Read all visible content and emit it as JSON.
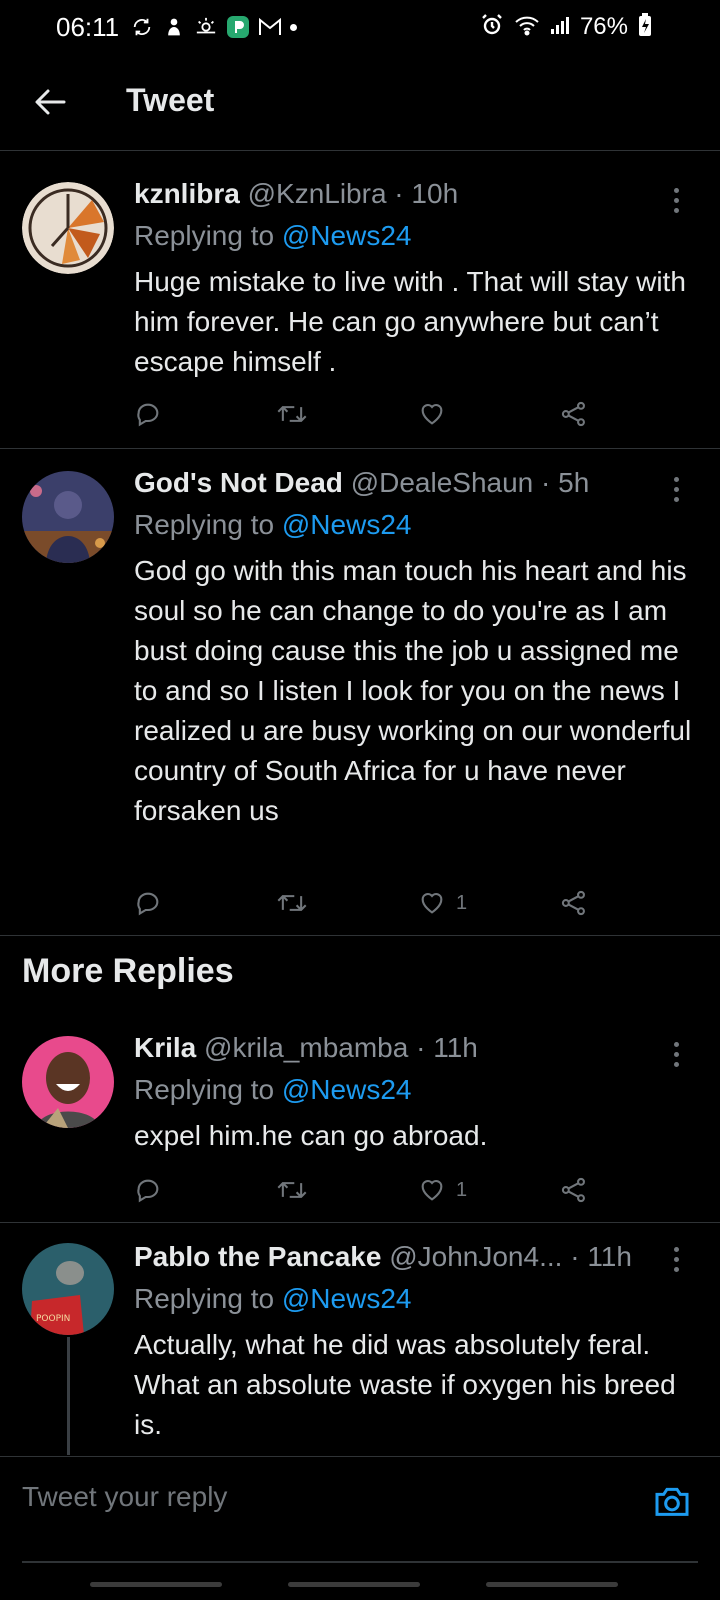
{
  "status_bar": {
    "time": "06:11",
    "battery": "76%",
    "left_icons": [
      "sync-icon",
      "person-icon",
      "weather-icon",
      "app-icon",
      "gmail-icon",
      "dot-icon"
    ],
    "right_icons": [
      "alarm-icon",
      "wifi-icon",
      "signal-icon",
      "battery-icon"
    ]
  },
  "header": {
    "title": "Tweet"
  },
  "tweets": [
    {
      "name": "kznlibra",
      "handle": "@KznLibra",
      "sep": " · ",
      "time": "10h",
      "replying_label": "Replying to ",
      "replying_to": "@News24",
      "body": "Huge mistake to live with . That will stay with him forever. He can go anywhere but can’t escape himself .",
      "likes": ""
    },
    {
      "name": "God's Not Dead",
      "handle": "@DealeShaun",
      "sep": " · ",
      "time": "5h",
      "replying_label": "Replying to ",
      "replying_to": "@News24",
      "body": "God go with this man touch his heart and his soul so he can change to do you're as I am bust doing cause this the job u assigned me to and so I listen I look for you on the news I realized u are busy working on our wonderful country of South Africa for u have never forsaken us",
      "likes": "1"
    }
  ],
  "more_replies": {
    "title": "More Replies",
    "tweets": [
      {
        "name": "Krila",
        "handle": "@krila_mbamba",
        "sep": " · ",
        "time": "11h",
        "replying_label": "Replying to ",
        "replying_to": "@News24",
        "body": "expel him.he can go abroad.",
        "likes": "1"
      },
      {
        "name": "Pablo the Pancake",
        "handle": "@JohnJon4...",
        "sep": "  · ",
        "time": "11h",
        "replying_label": "Replying to ",
        "replying_to": "@News24",
        "body": "Actually, what he did was absolutely feral. What an absolute waste if oxygen his breed is.",
        "likes": ""
      }
    ]
  },
  "composer": {
    "placeholder": "Tweet your reply"
  },
  "colors": {
    "accent": "#1d9bf0",
    "background": "#000000",
    "secondary_text": "#8b9198"
  }
}
